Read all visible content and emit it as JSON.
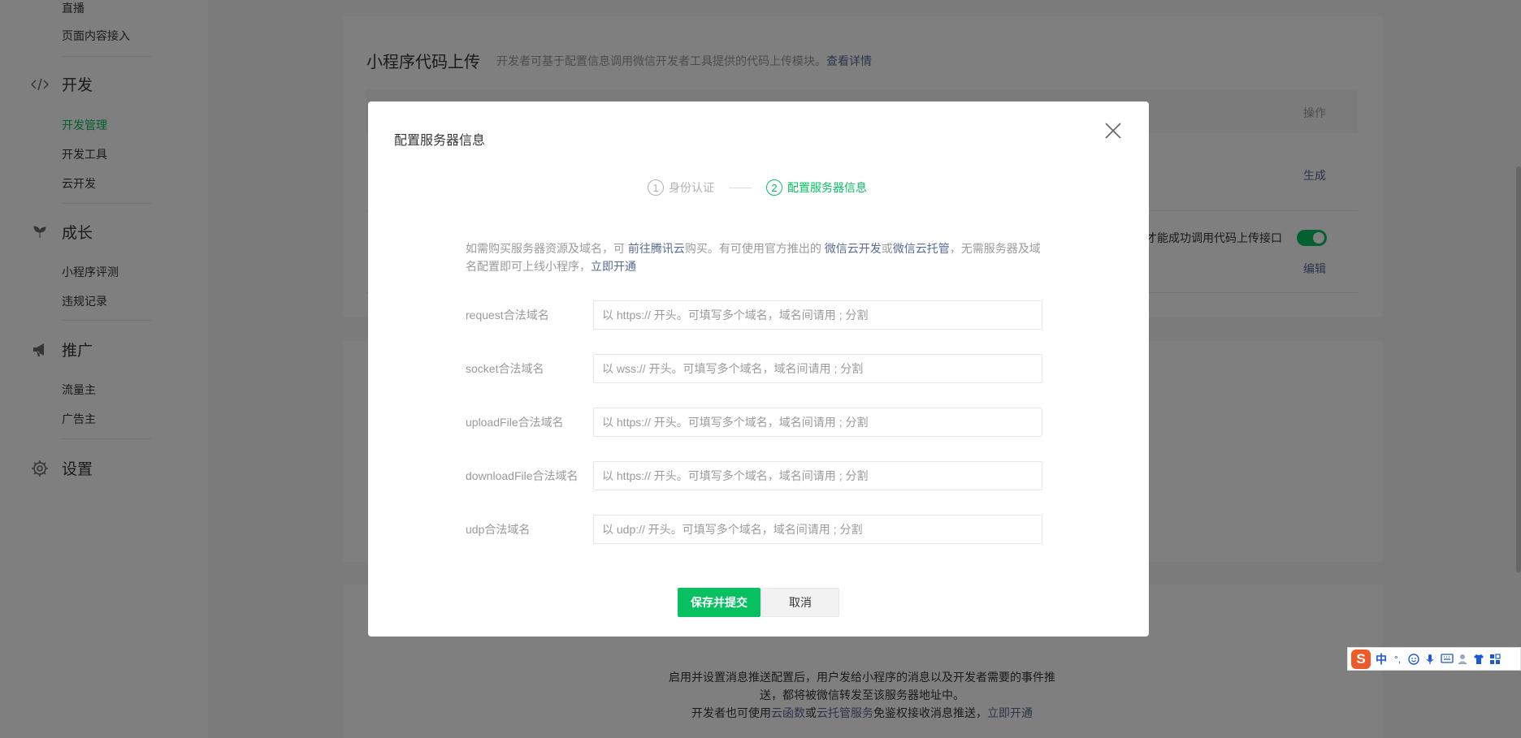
{
  "sidebar": {
    "top_items": [
      "直播",
      "页面内容接入"
    ],
    "groups": [
      {
        "label": "开发",
        "icon": "code-icon",
        "items": [
          "开发管理",
          "开发工具",
          "云开发"
        ],
        "active": "开发管理"
      },
      {
        "label": "成长",
        "icon": "sprout-icon",
        "items": [
          "小程序评测",
          "违规记录"
        ]
      },
      {
        "label": "推广",
        "icon": "megaphone-icon",
        "items": [
          "流量主",
          "广告主"
        ]
      },
      {
        "label": "设置",
        "icon": "gear-icon",
        "items": []
      }
    ]
  },
  "main": {
    "title": "小程序代码上传",
    "desc": "开发者可基于配置信息调用微信开发者工具提供的代码上传模块。",
    "desc_link": "查看详情",
    "op_header": "操作",
    "op_generate": "生成",
    "row2_text": "才能成功调用代码上传接口",
    "op_edit": "编辑",
    "bottom_line1": "启用并设置消息推送配置后，用户发给小程序的消息以及开发者需要的事件推",
    "bottom_line2": "送，都将被微信转发至该服务器地址中。",
    "bottom_line3_prefix": "开发者也可使用",
    "bottom_link1": "云函数",
    "bottom_or": "或",
    "bottom_link2": "云托管服务",
    "bottom_line3_mid": "免鉴权接收消息推送，",
    "bottom_link3": "立即开通"
  },
  "dialog": {
    "title": "配置服务器信息",
    "steps": [
      {
        "num": "1",
        "label": "身份认证",
        "state": "done"
      },
      {
        "num": "2",
        "label": "配置服务器信息",
        "state": "active"
      }
    ],
    "notice": {
      "p1": "如需购买服务器资源及域名，可",
      "link1": "前往腾讯云",
      "p2": "购买。有可使用官方推出的",
      "link2": "微信云开发",
      "p3": "或",
      "link3": "微信云托管",
      "p4": "，无需服务器及域名配置即可上线小程序，",
      "link4": "立即开通"
    },
    "fields": [
      {
        "label": "request合法域名",
        "placeholder": "以 https:// 开头。可填写多个域名，域名间请用 ; 分割",
        "value": ""
      },
      {
        "label": "socket合法域名",
        "placeholder": "以 wss:// 开头。可填写多个域名，域名间请用 ; 分割",
        "value": ""
      },
      {
        "label": "uploadFile合法域名",
        "placeholder": "以 https:// 开头。可填写多个域名，域名间请用 ; 分割",
        "value": ""
      },
      {
        "label": "downloadFile合法域名",
        "placeholder": "以 https:// 开头。可填写多个域名，域名间请用 ; 分割",
        "value": ""
      },
      {
        "label": "udp合法域名",
        "placeholder": "以 udp:// 开头。可填写多个域名，域名间请用 ; 分割",
        "value": ""
      }
    ],
    "submit_label": "保存并提交",
    "cancel_label": "取消"
  },
  "ime": {
    "logo": "S",
    "mode": "中",
    "punct": "°,",
    "icons": [
      "emoji-icon",
      "mic-icon",
      "keyboard-icon",
      "user-icon",
      "shirt-icon",
      "grid-icon"
    ]
  },
  "colors": {
    "accent": "#07c160",
    "link": "#576b95",
    "overlay": "rgba(0,0,0,0.5)"
  }
}
